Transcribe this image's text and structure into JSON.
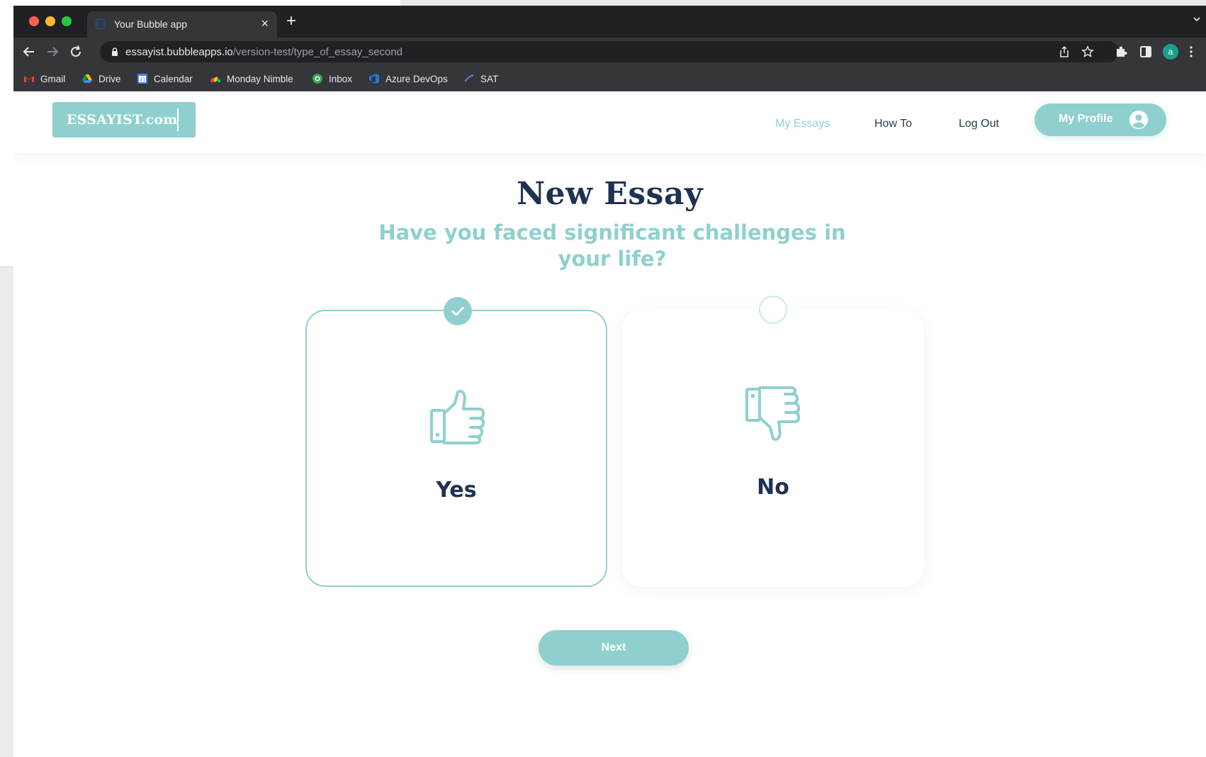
{
  "browser": {
    "tab_title": "Your Bubble app",
    "tab_close": "×",
    "new_tab": "+",
    "url_host": "essayist.bubbleapps.io",
    "url_path": "/version-test/type_of_essay_second",
    "profile_initial": "a",
    "bookmarks": [
      {
        "label": "Gmail",
        "icon": "gmail-icon"
      },
      {
        "label": "Drive",
        "icon": "drive-icon"
      },
      {
        "label": "Calendar",
        "icon": "calendar-icon"
      },
      {
        "label": "Monday Nimble",
        "icon": "monday-icon"
      },
      {
        "label": "Inbox",
        "icon": "inbox-icon"
      },
      {
        "label": "Azure DevOps",
        "icon": "azure-devops-icon"
      },
      {
        "label": "SAT",
        "icon": "sat-icon"
      }
    ]
  },
  "header": {
    "logo_text": "ESSAYIST.com",
    "nav": [
      {
        "label": "My Essays",
        "active": true
      },
      {
        "label": "How To",
        "active": false
      },
      {
        "label": "Log Out",
        "active": false
      }
    ],
    "profile_label": "My Profile"
  },
  "main": {
    "title": "New Essay",
    "question": "Have you faced significant challenges in your life?",
    "options": [
      {
        "label": "Yes",
        "selected": true,
        "icon": "thumbs-up-icon"
      },
      {
        "label": "No",
        "selected": false,
        "icon": "thumbs-down-icon"
      }
    ],
    "next_label": "Next"
  },
  "colors": {
    "accent": "#8fd0ce",
    "heading": "#1f3251",
    "chrome_dark": "#202124",
    "chrome_toolbar": "#35363a"
  }
}
